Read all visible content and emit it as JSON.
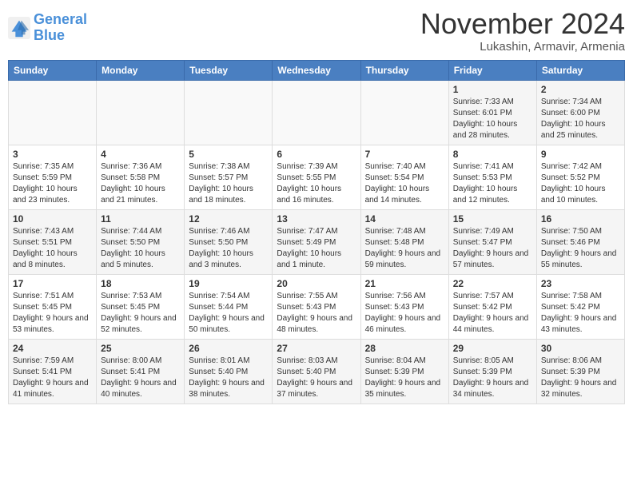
{
  "header": {
    "logo_line1": "General",
    "logo_line2": "Blue",
    "month": "November 2024",
    "location": "Lukashin, Armavir, Armenia"
  },
  "weekdays": [
    "Sunday",
    "Monday",
    "Tuesday",
    "Wednesday",
    "Thursday",
    "Friday",
    "Saturday"
  ],
  "weeks": [
    [
      {
        "day": "",
        "info": ""
      },
      {
        "day": "",
        "info": ""
      },
      {
        "day": "",
        "info": ""
      },
      {
        "day": "",
        "info": ""
      },
      {
        "day": "",
        "info": ""
      },
      {
        "day": "1",
        "info": "Sunrise: 7:33 AM\nSunset: 6:01 PM\nDaylight: 10 hours and 28 minutes."
      },
      {
        "day": "2",
        "info": "Sunrise: 7:34 AM\nSunset: 6:00 PM\nDaylight: 10 hours and 25 minutes."
      }
    ],
    [
      {
        "day": "3",
        "info": "Sunrise: 7:35 AM\nSunset: 5:59 PM\nDaylight: 10 hours and 23 minutes."
      },
      {
        "day": "4",
        "info": "Sunrise: 7:36 AM\nSunset: 5:58 PM\nDaylight: 10 hours and 21 minutes."
      },
      {
        "day": "5",
        "info": "Sunrise: 7:38 AM\nSunset: 5:57 PM\nDaylight: 10 hours and 18 minutes."
      },
      {
        "day": "6",
        "info": "Sunrise: 7:39 AM\nSunset: 5:55 PM\nDaylight: 10 hours and 16 minutes."
      },
      {
        "day": "7",
        "info": "Sunrise: 7:40 AM\nSunset: 5:54 PM\nDaylight: 10 hours and 14 minutes."
      },
      {
        "day": "8",
        "info": "Sunrise: 7:41 AM\nSunset: 5:53 PM\nDaylight: 10 hours and 12 minutes."
      },
      {
        "day": "9",
        "info": "Sunrise: 7:42 AM\nSunset: 5:52 PM\nDaylight: 10 hours and 10 minutes."
      }
    ],
    [
      {
        "day": "10",
        "info": "Sunrise: 7:43 AM\nSunset: 5:51 PM\nDaylight: 10 hours and 8 minutes."
      },
      {
        "day": "11",
        "info": "Sunrise: 7:44 AM\nSunset: 5:50 PM\nDaylight: 10 hours and 5 minutes."
      },
      {
        "day": "12",
        "info": "Sunrise: 7:46 AM\nSunset: 5:50 PM\nDaylight: 10 hours and 3 minutes."
      },
      {
        "day": "13",
        "info": "Sunrise: 7:47 AM\nSunset: 5:49 PM\nDaylight: 10 hours and 1 minute."
      },
      {
        "day": "14",
        "info": "Sunrise: 7:48 AM\nSunset: 5:48 PM\nDaylight: 9 hours and 59 minutes."
      },
      {
        "day": "15",
        "info": "Sunrise: 7:49 AM\nSunset: 5:47 PM\nDaylight: 9 hours and 57 minutes."
      },
      {
        "day": "16",
        "info": "Sunrise: 7:50 AM\nSunset: 5:46 PM\nDaylight: 9 hours and 55 minutes."
      }
    ],
    [
      {
        "day": "17",
        "info": "Sunrise: 7:51 AM\nSunset: 5:45 PM\nDaylight: 9 hours and 53 minutes."
      },
      {
        "day": "18",
        "info": "Sunrise: 7:53 AM\nSunset: 5:45 PM\nDaylight: 9 hours and 52 minutes."
      },
      {
        "day": "19",
        "info": "Sunrise: 7:54 AM\nSunset: 5:44 PM\nDaylight: 9 hours and 50 minutes."
      },
      {
        "day": "20",
        "info": "Sunrise: 7:55 AM\nSunset: 5:43 PM\nDaylight: 9 hours and 48 minutes."
      },
      {
        "day": "21",
        "info": "Sunrise: 7:56 AM\nSunset: 5:43 PM\nDaylight: 9 hours and 46 minutes."
      },
      {
        "day": "22",
        "info": "Sunrise: 7:57 AM\nSunset: 5:42 PM\nDaylight: 9 hours and 44 minutes."
      },
      {
        "day": "23",
        "info": "Sunrise: 7:58 AM\nSunset: 5:42 PM\nDaylight: 9 hours and 43 minutes."
      }
    ],
    [
      {
        "day": "24",
        "info": "Sunrise: 7:59 AM\nSunset: 5:41 PM\nDaylight: 9 hours and 41 minutes."
      },
      {
        "day": "25",
        "info": "Sunrise: 8:00 AM\nSunset: 5:41 PM\nDaylight: 9 hours and 40 minutes."
      },
      {
        "day": "26",
        "info": "Sunrise: 8:01 AM\nSunset: 5:40 PM\nDaylight: 9 hours and 38 minutes."
      },
      {
        "day": "27",
        "info": "Sunrise: 8:03 AM\nSunset: 5:40 PM\nDaylight: 9 hours and 37 minutes."
      },
      {
        "day": "28",
        "info": "Sunrise: 8:04 AM\nSunset: 5:39 PM\nDaylight: 9 hours and 35 minutes."
      },
      {
        "day": "29",
        "info": "Sunrise: 8:05 AM\nSunset: 5:39 PM\nDaylight: 9 hours and 34 minutes."
      },
      {
        "day": "30",
        "info": "Sunrise: 8:06 AM\nSunset: 5:39 PM\nDaylight: 9 hours and 32 minutes."
      }
    ]
  ]
}
